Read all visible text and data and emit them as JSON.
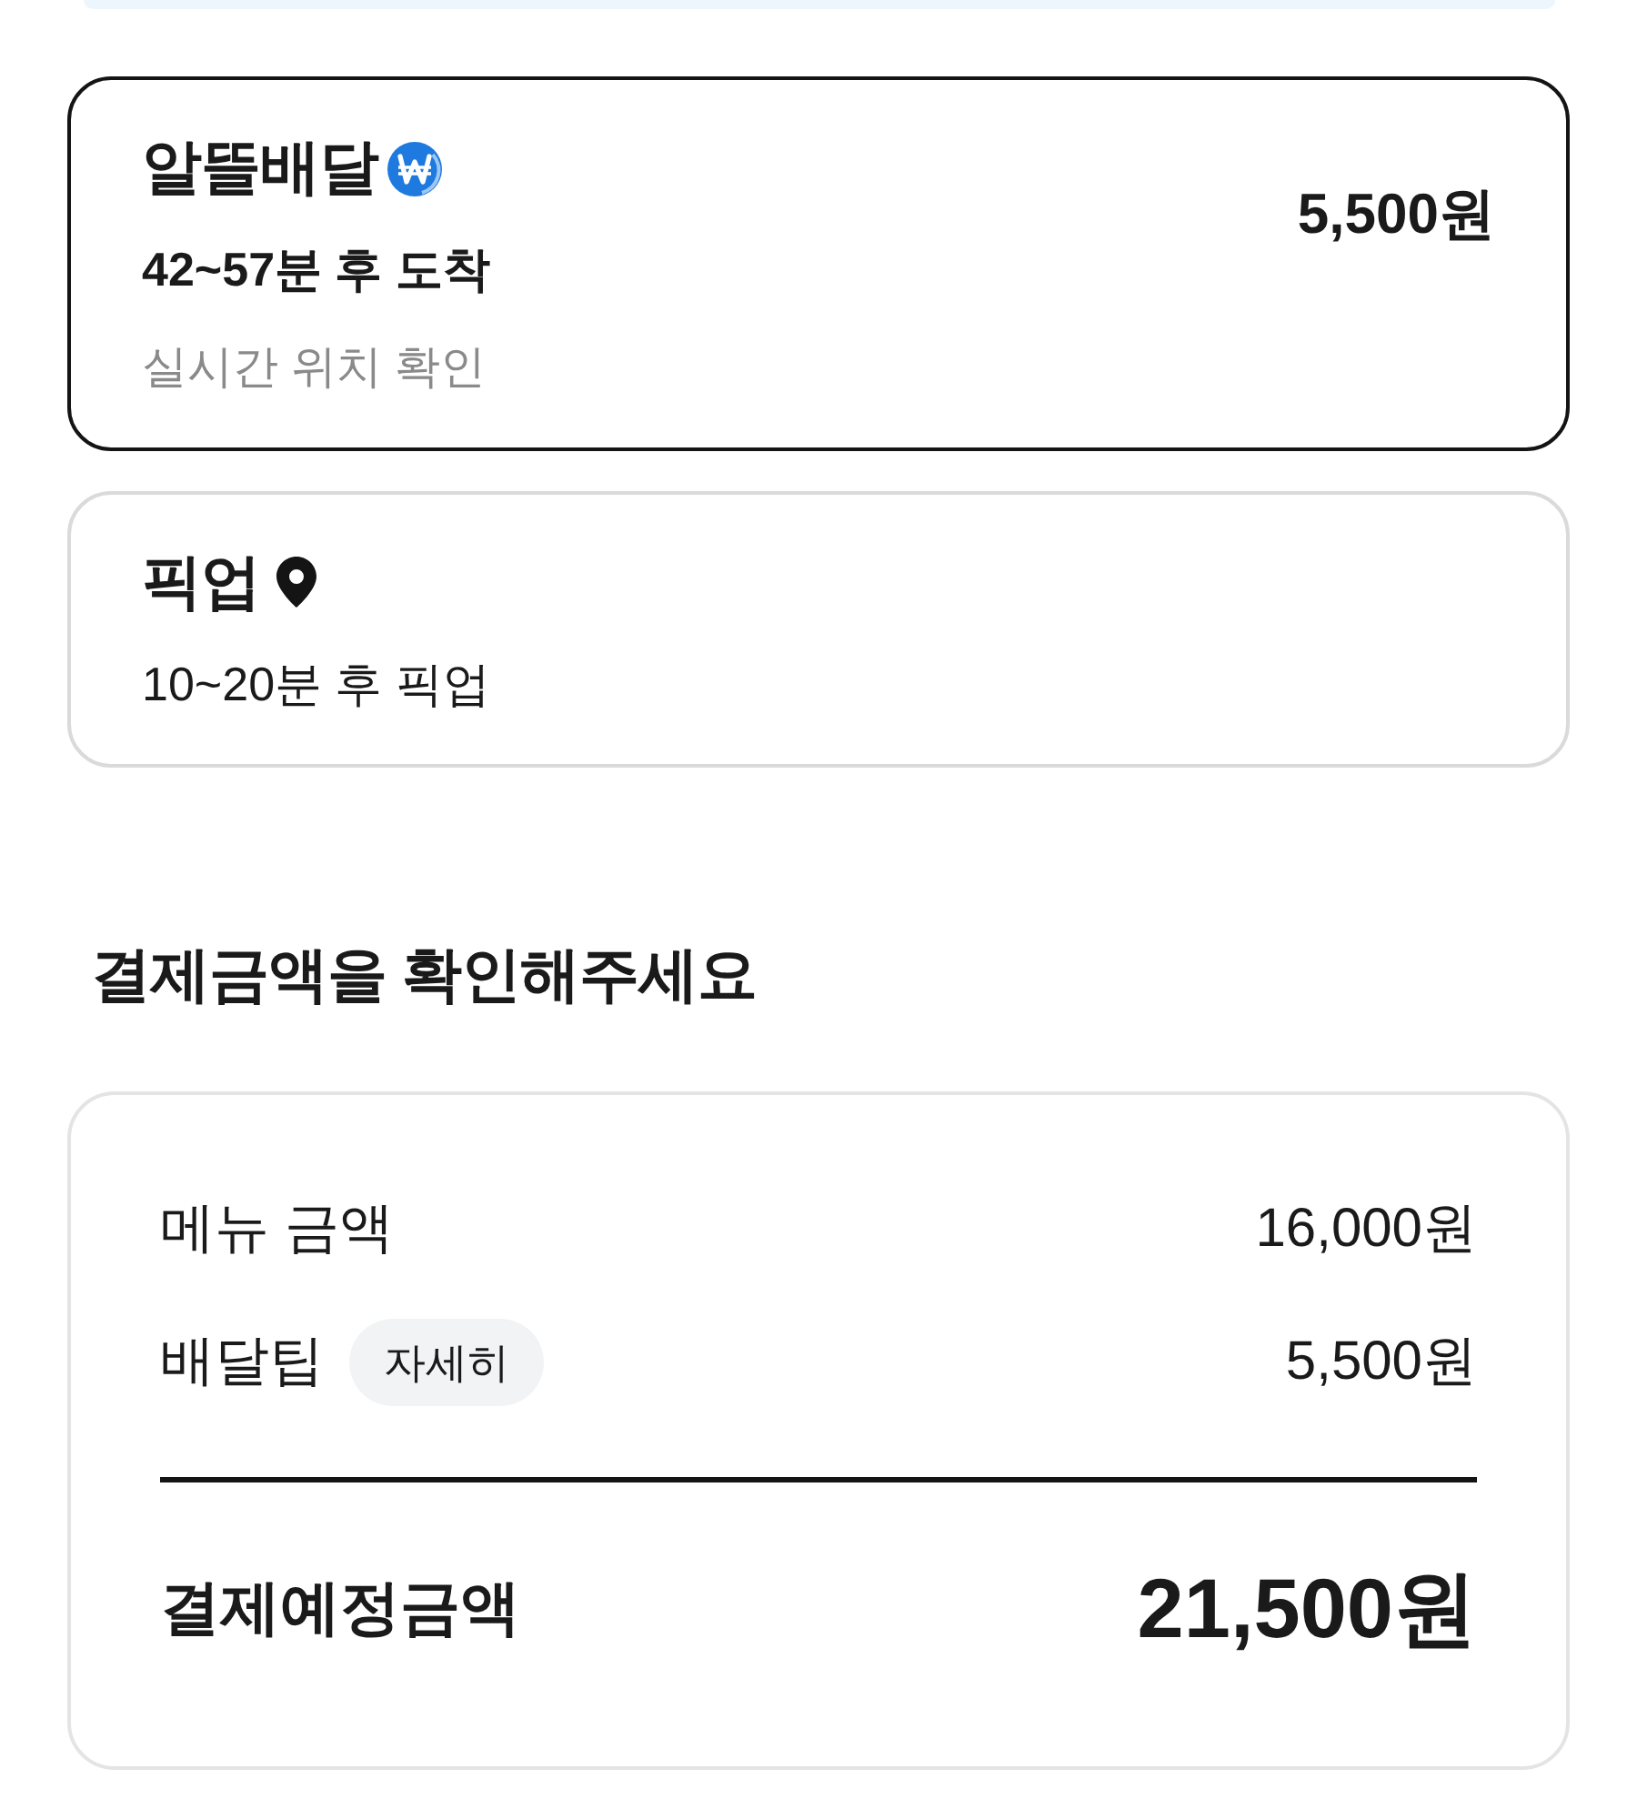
{
  "delivery_options": [
    {
      "kind": "delivery",
      "name": "알뜰배달",
      "eta": "42~57분 후 도착",
      "note": "실시간 위치 확인",
      "price": "5,500원",
      "selected": true
    },
    {
      "kind": "pickup",
      "name": "픽업",
      "eta": "10~20분 후 픽업",
      "selected": false
    }
  ],
  "payment": {
    "heading": "결제금액을 확인해주세요",
    "items": [
      {
        "label": "메뉴 금액",
        "amount": "16,000원"
      },
      {
        "label": "배달팁",
        "chip": "자세히",
        "amount": "5,500원"
      }
    ],
    "total": {
      "label": "결제예정금액",
      "amount": "21,500원"
    }
  }
}
